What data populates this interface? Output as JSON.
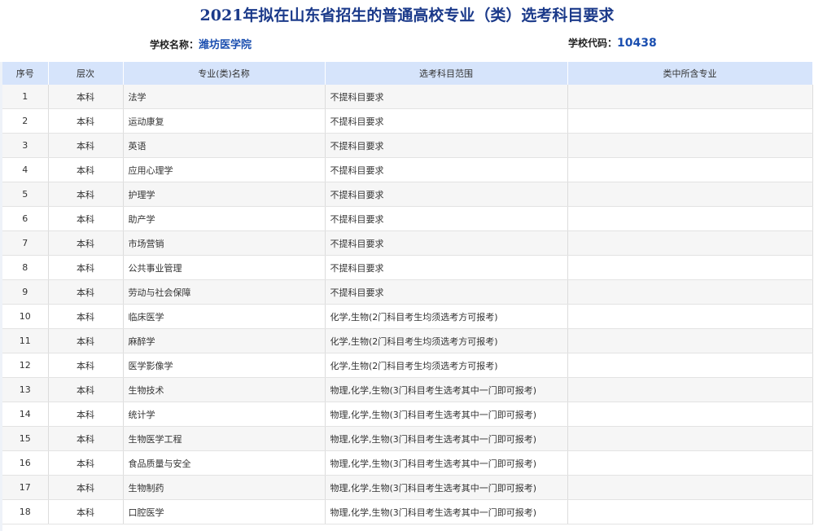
{
  "header": {
    "title": "2021年拟在山东省招生的普通高校专业（类）选考科目要求",
    "school_label": "学校名称：",
    "school_name": "潍坊医学院",
    "code_label": "学校代码：",
    "code_value": "10438"
  },
  "table": {
    "columns": [
      "序号",
      "层次",
      "专业(类)名称",
      "选考科目范围",
      "类中所含专业"
    ],
    "rows": [
      {
        "no": "1",
        "level": "本科",
        "major": "法学",
        "subjects": "不提科目要求",
        "included": ""
      },
      {
        "no": "2",
        "level": "本科",
        "major": "运动康复",
        "subjects": "不提科目要求",
        "included": ""
      },
      {
        "no": "3",
        "level": "本科",
        "major": "英语",
        "subjects": "不提科目要求",
        "included": ""
      },
      {
        "no": "4",
        "level": "本科",
        "major": "应用心理学",
        "subjects": "不提科目要求",
        "included": ""
      },
      {
        "no": "5",
        "level": "本科",
        "major": "护理学",
        "subjects": "不提科目要求",
        "included": ""
      },
      {
        "no": "6",
        "level": "本科",
        "major": "助产学",
        "subjects": "不提科目要求",
        "included": ""
      },
      {
        "no": "7",
        "level": "本科",
        "major": "市场营销",
        "subjects": "不提科目要求",
        "included": ""
      },
      {
        "no": "8",
        "level": "本科",
        "major": "公共事业管理",
        "subjects": "不提科目要求",
        "included": ""
      },
      {
        "no": "9",
        "level": "本科",
        "major": "劳动与社会保障",
        "subjects": "不提科目要求",
        "included": ""
      },
      {
        "no": "10",
        "level": "本科",
        "major": "临床医学",
        "subjects": "化学,生物(2门科目考生均须选考方可报考)",
        "included": ""
      },
      {
        "no": "11",
        "level": "本科",
        "major": "麻醉学",
        "subjects": "化学,生物(2门科目考生均须选考方可报考)",
        "included": ""
      },
      {
        "no": "12",
        "level": "本科",
        "major": "医学影像学",
        "subjects": "化学,生物(2门科目考生均须选考方可报考)",
        "included": ""
      },
      {
        "no": "13",
        "level": "本科",
        "major": "生物技术",
        "subjects": "物理,化学,生物(3门科目考生选考其中一门即可报考)",
        "included": ""
      },
      {
        "no": "14",
        "level": "本科",
        "major": "统计学",
        "subjects": "物理,化学,生物(3门科目考生选考其中一门即可报考)",
        "included": ""
      },
      {
        "no": "15",
        "level": "本科",
        "major": "生物医学工程",
        "subjects": "物理,化学,生物(3门科目考生选考其中一门即可报考)",
        "included": ""
      },
      {
        "no": "16",
        "level": "本科",
        "major": "食品质量与安全",
        "subjects": "物理,化学,生物(3门科目考生选考其中一门即可报考)",
        "included": ""
      },
      {
        "no": "17",
        "level": "本科",
        "major": "生物制药",
        "subjects": "物理,化学,生物(3门科目考生选考其中一门即可报考)",
        "included": ""
      },
      {
        "no": "18",
        "level": "本科",
        "major": "口腔医学",
        "subjects": "物理,化学,生物(3门科目考生选考其中一门即可报考)",
        "included": ""
      }
    ]
  }
}
